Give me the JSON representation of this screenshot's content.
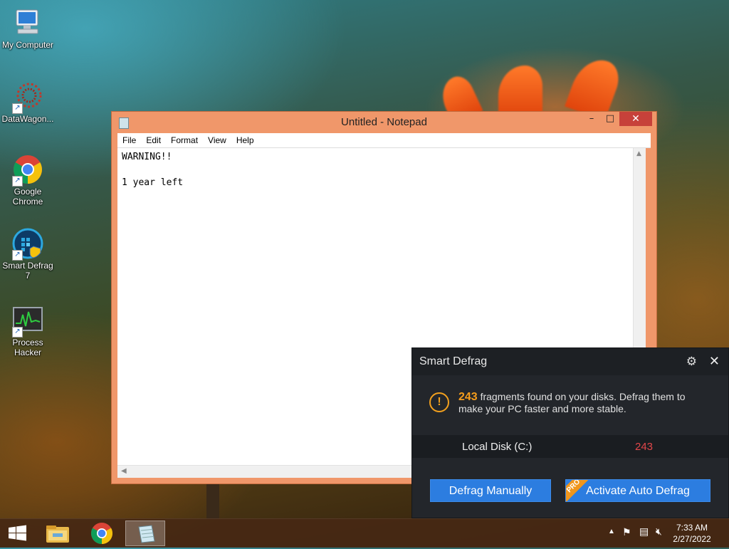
{
  "desktop": {
    "icons": [
      {
        "label": "My Computer",
        "icon": "computer-icon"
      },
      {
        "label": "DataWagon...",
        "icon": "datawagon-icon"
      },
      {
        "label": "Google Chrome",
        "icon": "chrome-icon"
      },
      {
        "label": "Smart Defrag 7",
        "icon": "smart-defrag-icon"
      },
      {
        "label": "Process Hacker",
        "icon": "process-hacker-icon"
      }
    ]
  },
  "notepad": {
    "title": "Untitled - Notepad",
    "controls": {
      "minimize": "–",
      "maximize": "□",
      "close": "✕"
    },
    "menu": [
      "File",
      "Edit",
      "Format",
      "View",
      "Help"
    ],
    "content": "WARNING!!\n\n1 year left"
  },
  "smart_defrag": {
    "title": "Smart Defrag",
    "fragment_count": "243",
    "message": "fragments found on your disks. Defrag them to make your PC faster and more stable.",
    "disk_name": "Local Disk (C:)",
    "disk_fragments": "243",
    "btn_manual": "Defrag Manually",
    "btn_auto": "Activate Auto Defrag",
    "pro_badge": "PRO",
    "accent": "#f59d1c",
    "button_color": "#2c7de0",
    "disk_count_color": "#e2474a"
  },
  "taskbar": {
    "items": [
      "start-button",
      "file-explorer",
      "google-chrome",
      "notepad"
    ],
    "clock_time": "7:33 AM",
    "clock_date": "2/27/2022"
  }
}
